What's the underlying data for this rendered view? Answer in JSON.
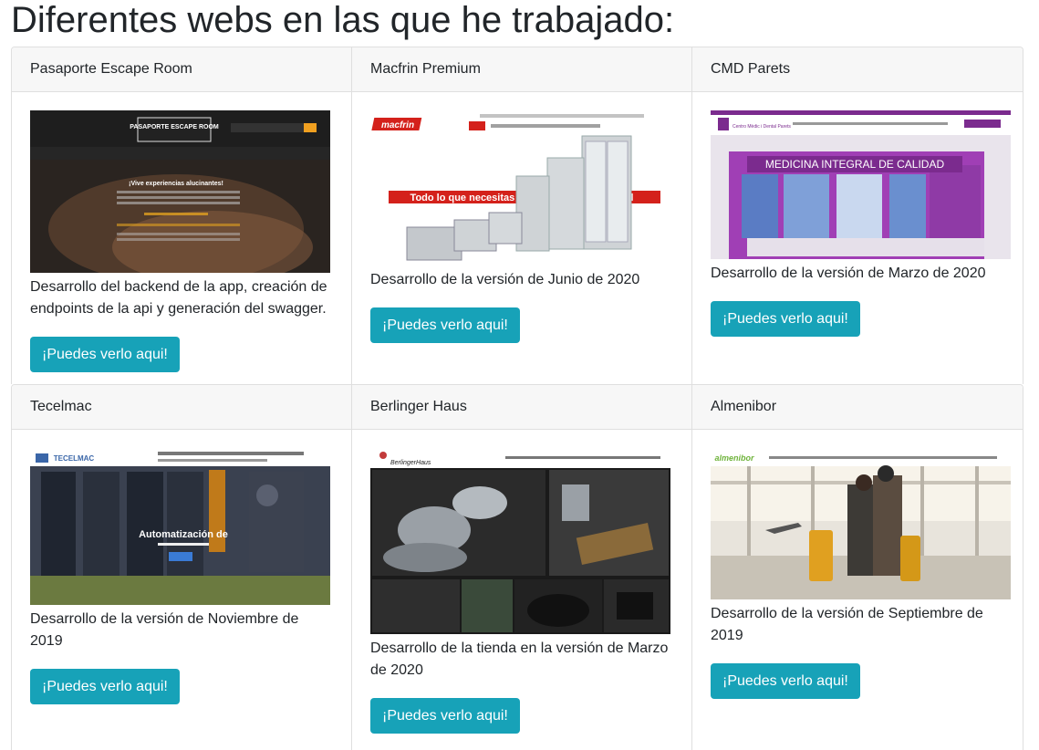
{
  "title": "Diferentes webs en las que he trabajado:",
  "cards": [
    {
      "name": "Pasaporte Escape Room",
      "desc": "Desarrollo del backend de la app, creación de endpoints de la api y generación del swagger.",
      "button": "¡Puedes verlo aqui!",
      "thumb": {
        "brand": "PASAPORTE ESCAPE ROOM",
        "headline": "¡Vive experiencias alucinantes!"
      }
    },
    {
      "name": "Macfrin Premium",
      "desc": "Desarrollo de la versión de Junio de 2020",
      "button": "¡Puedes verlo aqui!",
      "thumb": {
        "brand": "macfrin",
        "headline": "Todo lo que necesitas para tu cocina industrial"
      }
    },
    {
      "name": "CMD Parets",
      "desc": "Desarrollo de la versión de Marzo de 2020",
      "button": "¡Puedes verlo aqui!",
      "thumb": {
        "brand": "Centro Mèdic i Dental Parets",
        "headline": "MEDICINA INTEGRAL DE CALIDAD"
      }
    },
    {
      "name": "Tecelmac",
      "desc": "Desarrollo de la versión de Noviembre de 2019",
      "button": "¡Puedes verlo aqui!",
      "thumb": {
        "brand": "TECELMAC",
        "headline": "Automatización de"
      }
    },
    {
      "name": "Berlinger Haus",
      "desc": "Desarrollo de la tienda en la versión de Marzo de 2020",
      "button": "¡Puedes verlo aqui!",
      "thumb": {
        "brand": "BerlingerHaus",
        "headline": ""
      }
    },
    {
      "name": "Almenibor",
      "desc": "Desarrollo de la versión de Septiembre de 2019",
      "button": "¡Puedes verlo aqui!",
      "thumb": {
        "brand": "almenibor",
        "headline": ""
      }
    }
  ]
}
